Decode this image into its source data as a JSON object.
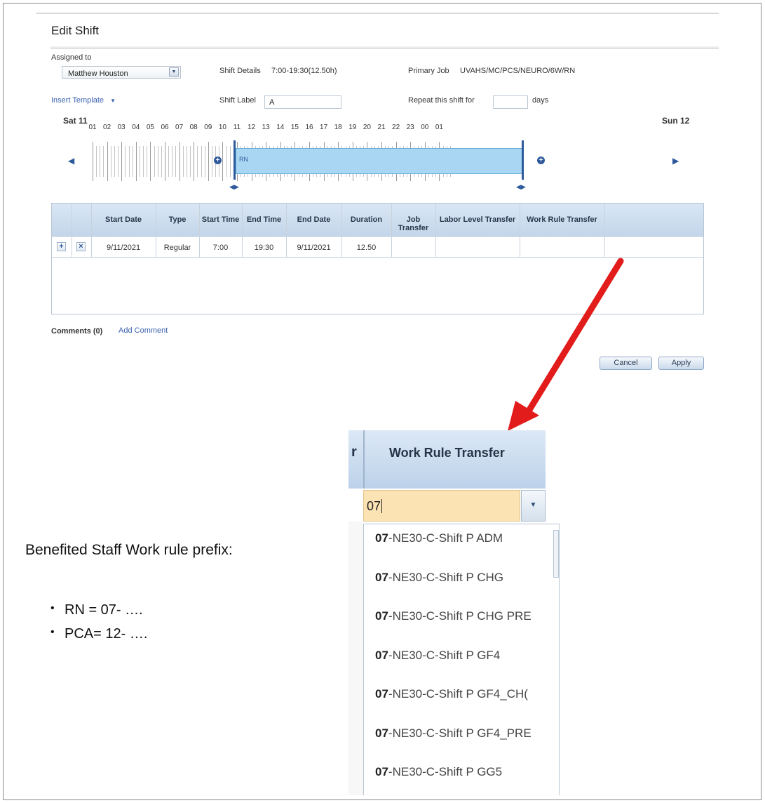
{
  "dialog": {
    "title": "Edit Shift",
    "assigned_to_label": "Assigned to",
    "assigned_to_value": "Matthew Houston",
    "shift_details_label": "Shift Details",
    "shift_details_value": "7:00-19:30(12.50h)",
    "primary_job_label": "Primary Job",
    "primary_job_value": "UVAHS/MC/PCS/NEURO/6W/RN",
    "insert_template_label": "Insert Template",
    "shift_label_label": "Shift Label",
    "shift_label_value": "A",
    "repeat_label": "Repeat this shift for",
    "repeat_value": "",
    "days_label": "days"
  },
  "timeline": {
    "start_day": "Sat 11",
    "end_day": "Sun 12",
    "hours": [
      "01",
      "02",
      "03",
      "04",
      "05",
      "06",
      "07",
      "08",
      "09",
      "10",
      "11",
      "12",
      "13",
      "14",
      "15",
      "16",
      "17",
      "18",
      "19",
      "20",
      "21",
      "22",
      "23",
      "00",
      "01"
    ],
    "shift_bar_label": "RN",
    "shift_start_hour": 7,
    "shift_end_hour": 19.5
  },
  "grid": {
    "columns": [
      "Start Date",
      "Type",
      "Start Time",
      "End Time",
      "End Date",
      "Duration",
      "Job Transfer",
      "Labor Level Transfer",
      "Work Rule Transfer"
    ],
    "rows": [
      {
        "start_date": "9/11/2021",
        "type": "Regular",
        "start_time": "7:00",
        "end_time": "19:30",
        "end_date": "9/11/2021",
        "duration": "12.50",
        "job_transfer": "",
        "labor_level_transfer": "",
        "work_rule_transfer": ""
      }
    ]
  },
  "comments": {
    "label": "Comments (0)",
    "add_link": "Add Comment"
  },
  "buttons": {
    "cancel": "Cancel",
    "apply": "Apply"
  },
  "zoom": {
    "header_fragment": "r",
    "header": "Work Rule Transfer",
    "input_value": "07",
    "items": [
      {
        "prefix": "07",
        "rest": "-NE30-C-Shift P ADM"
      },
      {
        "prefix": "07",
        "rest": "-NE30-C-Shift P CHG"
      },
      {
        "prefix": "07",
        "rest": "-NE30-C-Shift P CHG PRE"
      },
      {
        "prefix": "07",
        "rest": "-NE30-C-Shift P GF4"
      },
      {
        "prefix": "07",
        "rest": "-NE30-C-Shift P GF4_CH("
      },
      {
        "prefix": "07",
        "rest": "-NE30-C-Shift P GF4_PRE"
      },
      {
        "prefix": "07",
        "rest": "-NE30-C-Shift P GG5"
      }
    ]
  },
  "note": {
    "title": "Benefited Staff Work rule prefix:",
    "bullets": [
      "RN = 07- ….",
      "PCA= 12- …."
    ]
  },
  "colors": {
    "accent": "#2e5a9c",
    "shift_bar": "#a9d7f3",
    "arrow": "#e21b1b",
    "input_highlight": "#fce3b4"
  }
}
